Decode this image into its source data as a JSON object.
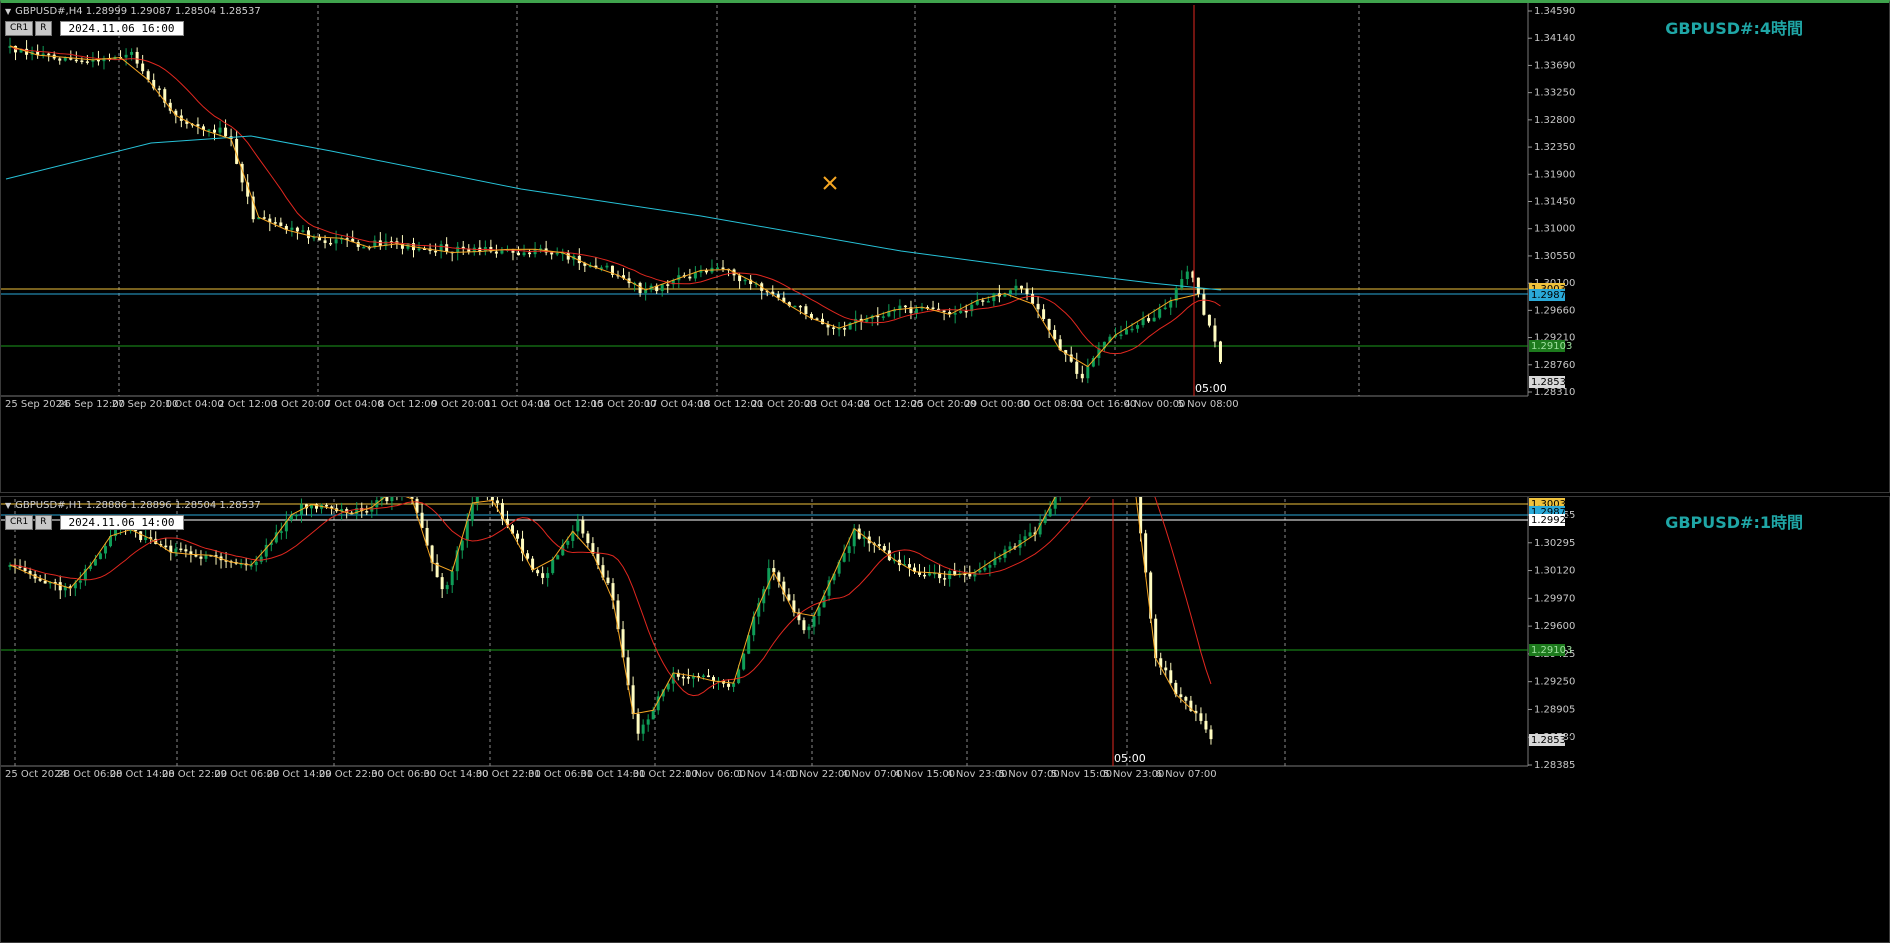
{
  "top_chart": {
    "header": "GBPUSD#,H4  1.28999 1.29087 1.28504 1.28537",
    "btn1": "CR1",
    "btn2": "R",
    "datetime": "2024.11.06 16:00",
    "title": "GBPUSD#:4時間",
    "price_labels": [
      "1.34590",
      "1.34140",
      "1.33690",
      "1.33250",
      "1.32800",
      "1.32350",
      "1.31900",
      "1.31450",
      "1.31000",
      "1.30550",
      "1.30100",
      "1.29660",
      "1.29210",
      "1.28760",
      "1.28310"
    ],
    "level_labels": [
      {
        "text": "1.30033",
        "bg": "#f0c23c",
        "fg": "#000"
      },
      {
        "text": "1.29871",
        "bg": "#2aa9d8",
        "fg": "#000"
      },
      {
        "text": "1.29103",
        "bg": "#1d7a1d",
        "fg": "#9fe09f"
      },
      {
        "text": "1.28537",
        "bg": "#d8d8d8",
        "fg": "#000"
      }
    ],
    "time_labels": [
      "25 Sep 2024",
      "26 Sep 12:00",
      "27 Sep 20:00",
      "1 Oct 04:00",
      "2 Oct 12:00",
      "3 Oct 20:00",
      "7 Oct 04:00",
      "8 Oct 12:00",
      "9 Oct 20:00",
      "11 Oct 04:00",
      "14 Oct 12:00",
      "15 Oct 20:00",
      "17 Oct 04:00",
      "18 Oct 12:00",
      "21 Oct 20:00",
      "23 Oct 04:00",
      "24 Oct 12:00",
      "25 Oct 20:00",
      "29 Oct 00:00",
      "30 Oct 08:00",
      "31 Oct 16:00",
      "4 Nov 00:00",
      "5 Nov 08:00"
    ],
    "cursor_label": "05:00"
  },
  "bottom_chart": {
    "header": "GBPUSD#,H1  1.28886 1.28896 1.28504 1.28537",
    "btn1": "CR1",
    "btn2": "R",
    "datetime": "2024.11.06 14:00",
    "title": "GBPUSD#:1時間",
    "price_labels": [
      "1.30465",
      "1.30295",
      "1.30120",
      "1.29970",
      "1.29600",
      "1.29425",
      "1.29250",
      "1.28905",
      "1.28730",
      "1.28385"
    ],
    "level_labels": [
      {
        "text": "1.30033",
        "bg": "#f0c23c",
        "fg": "#000"
      },
      {
        "text": "1.29871",
        "bg": "#2aa9d8",
        "fg": "#000"
      },
      {
        "text": "1.29927",
        "bg": "#ffffff",
        "fg": "#000"
      },
      {
        "text": "1.29103",
        "bg": "#1d7a1d",
        "fg": "#9fe09f"
      },
      {
        "text": "1.28537",
        "bg": "#d8d8d8",
        "fg": "#000"
      }
    ],
    "time_labels": [
      "25 Oct 2024",
      "28 Oct 06:00",
      "28 Oct 14:00",
      "28 Oct 22:00",
      "29 Oct 06:00",
      "29 Oct 14:00",
      "29 Oct 22:00",
      "30 Oct 06:00",
      "30 Oct 14:00",
      "30 Oct 22:00",
      "31 Oct 06:00",
      "31 Oct 14:00",
      "31 Oct 22:00",
      "1 Nov 06:00",
      "1 Nov 14:00",
      "1 Nov 22:00",
      "4 Nov 07:00",
      "4 Nov 15:00",
      "4 Nov 23:00",
      "5 Nov 07:00",
      "5 Nov 15:00",
      "5 Nov 23:00",
      "6 Nov 07:00"
    ],
    "cursor_label": "05:00"
  },
  "colors": {
    "bull": "#0f9d58",
    "bear": "#fffcc0",
    "ma_fast": "#e0271f",
    "ma_slow": "#27c2d8",
    "zigzag": "#f5a623",
    "grid": "#8a8a8a",
    "cursor": "#e0271f",
    "level_yellow": "#f0c23c",
    "level_blue": "#2aa9d8",
    "level_white": "#ffffff",
    "level_green": "#1d9a1d"
  },
  "icons": {
    "cursor_marker": "crossed-pencil-icon"
  }
}
